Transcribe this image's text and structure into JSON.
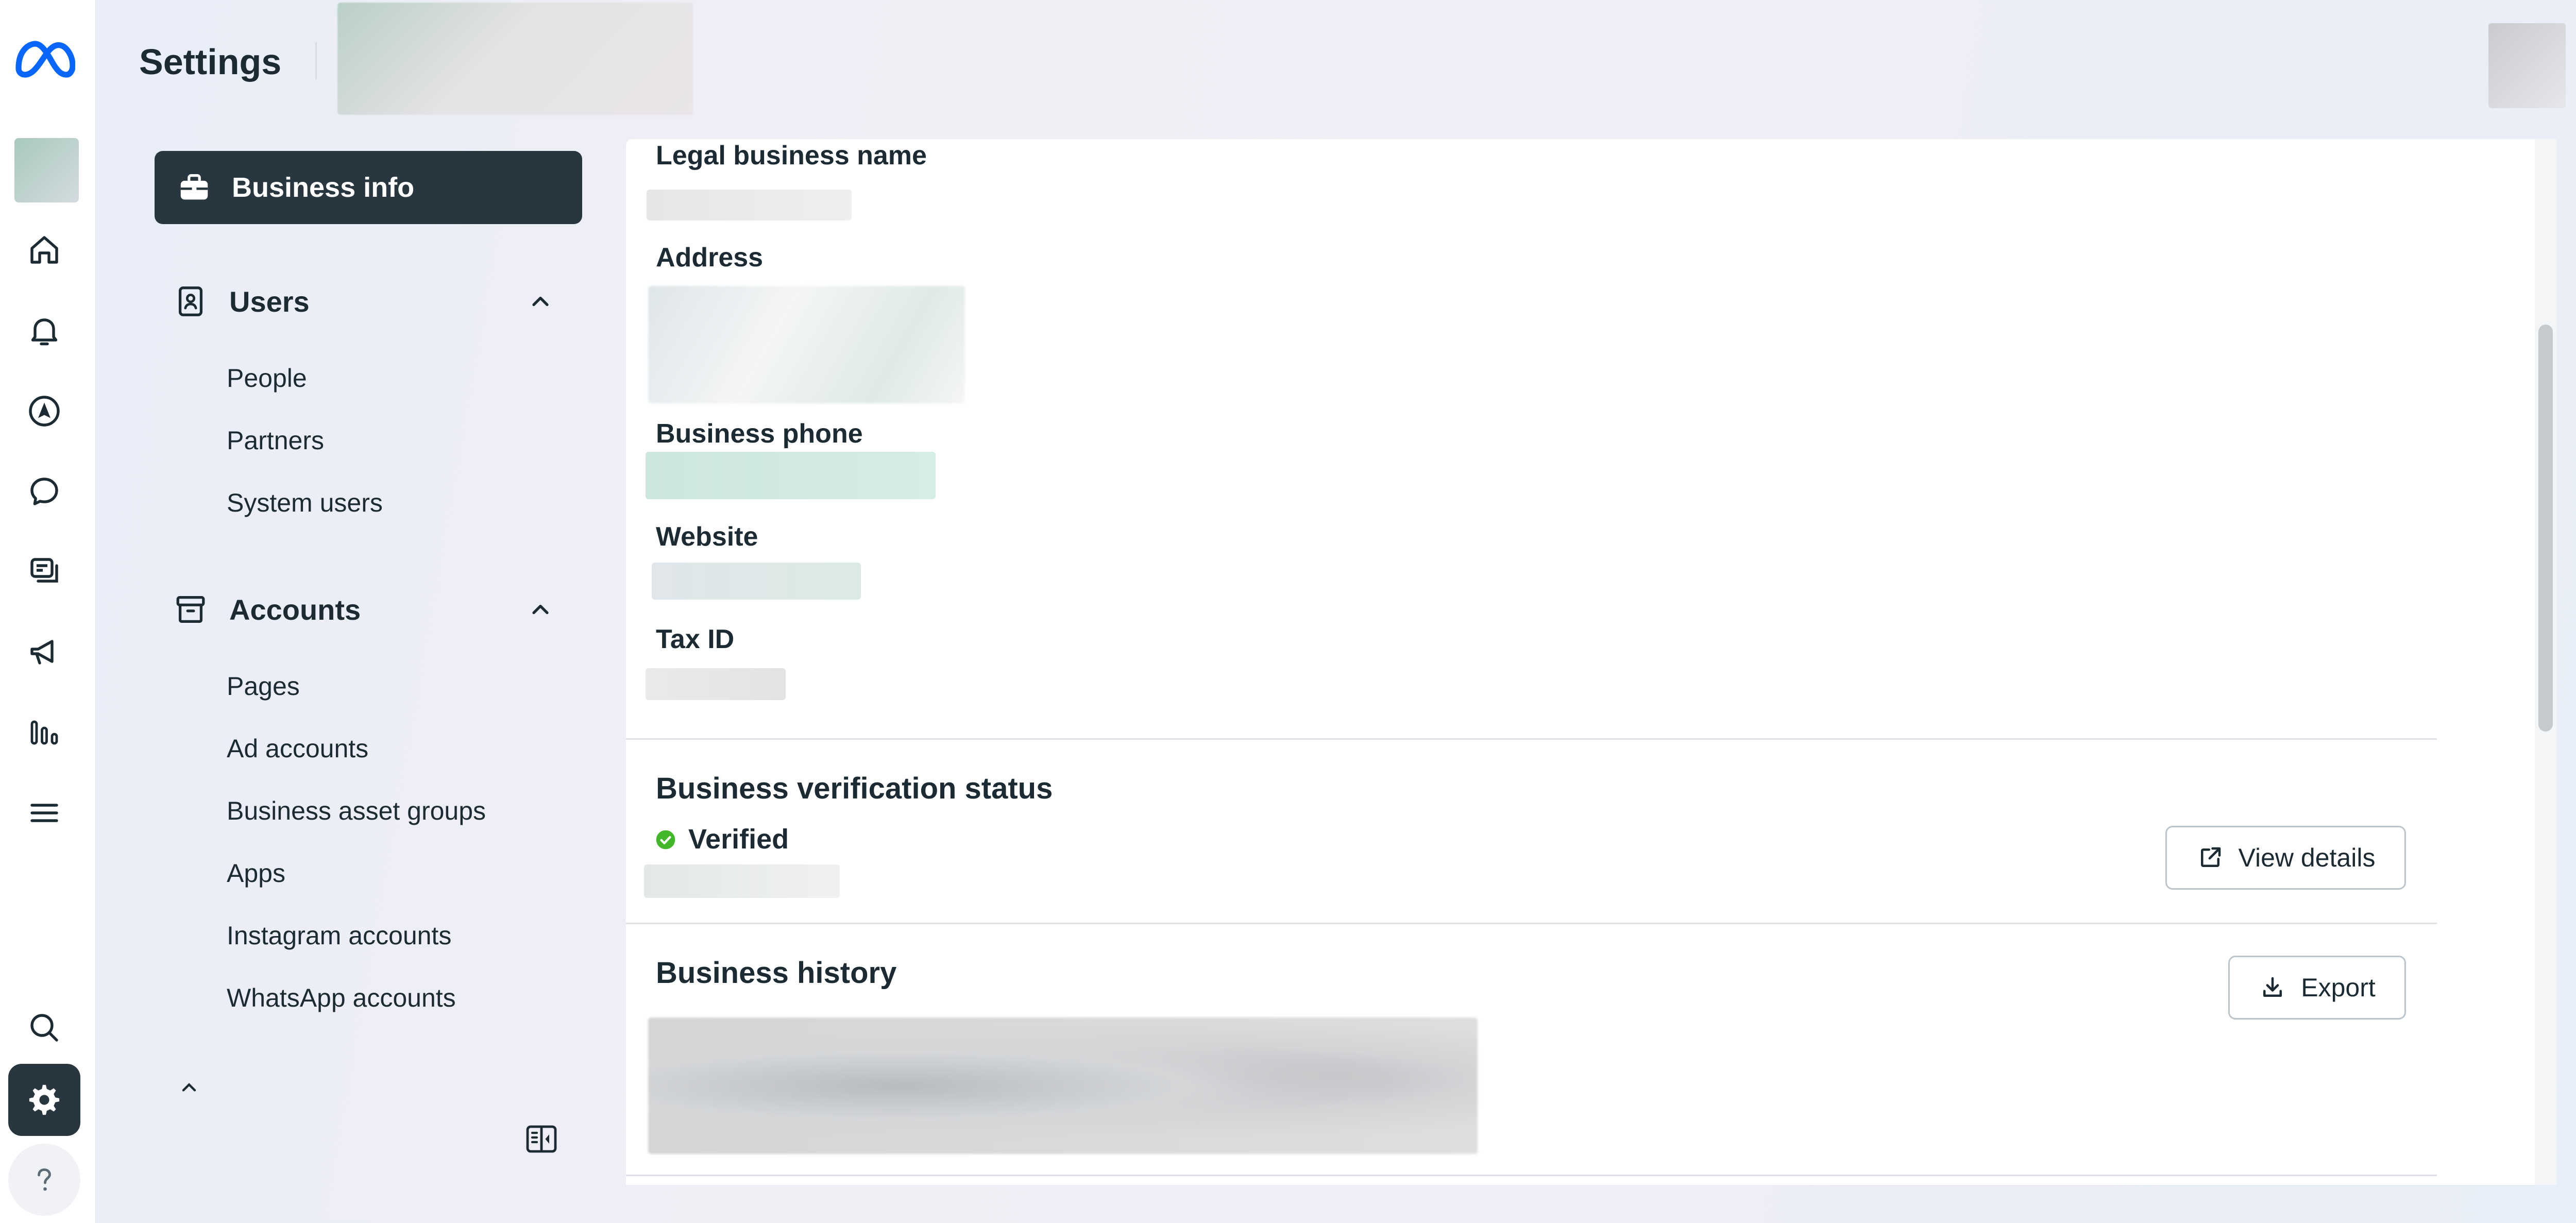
{
  "header": {
    "title": "Settings"
  },
  "sidebar": {
    "active_item": {
      "label": "Business info",
      "icon": "briefcase-icon"
    },
    "sections": [
      {
        "label": "Users",
        "icon": "user-badge-icon",
        "expanded": true,
        "items": [
          "People",
          "Partners",
          "System users"
        ]
      },
      {
        "label": "Accounts",
        "icon": "archive-box-icon",
        "expanded": true,
        "items": [
          "Pages",
          "Ad accounts",
          "Business asset groups",
          "Apps",
          "Instagram accounts",
          "WhatsApp accounts"
        ]
      }
    ]
  },
  "rail": {
    "icons": [
      "meta-logo-icon",
      "home-icon",
      "bell-icon",
      "navigation-arrow-icon",
      "chat-bubble-icon",
      "cards-icon",
      "megaphone-icon",
      "bar-chart-icon",
      "menu-icon",
      "search-icon",
      "gear-icon",
      "help-icon"
    ]
  },
  "main": {
    "fields": {
      "legal_name": "Legal business name",
      "address": "Address",
      "phone": "Business phone",
      "website": "Website",
      "tax_id": "Tax ID"
    },
    "verification": {
      "title": "Business verification status",
      "status": "Verified",
      "status_color": "#42b72a",
      "button": "View details"
    },
    "history": {
      "title": "Business history",
      "button": "Export"
    }
  },
  "colors": {
    "dark_active": "#283640",
    "text": "#1c2b33",
    "meta_blue": "#0866ff"
  }
}
